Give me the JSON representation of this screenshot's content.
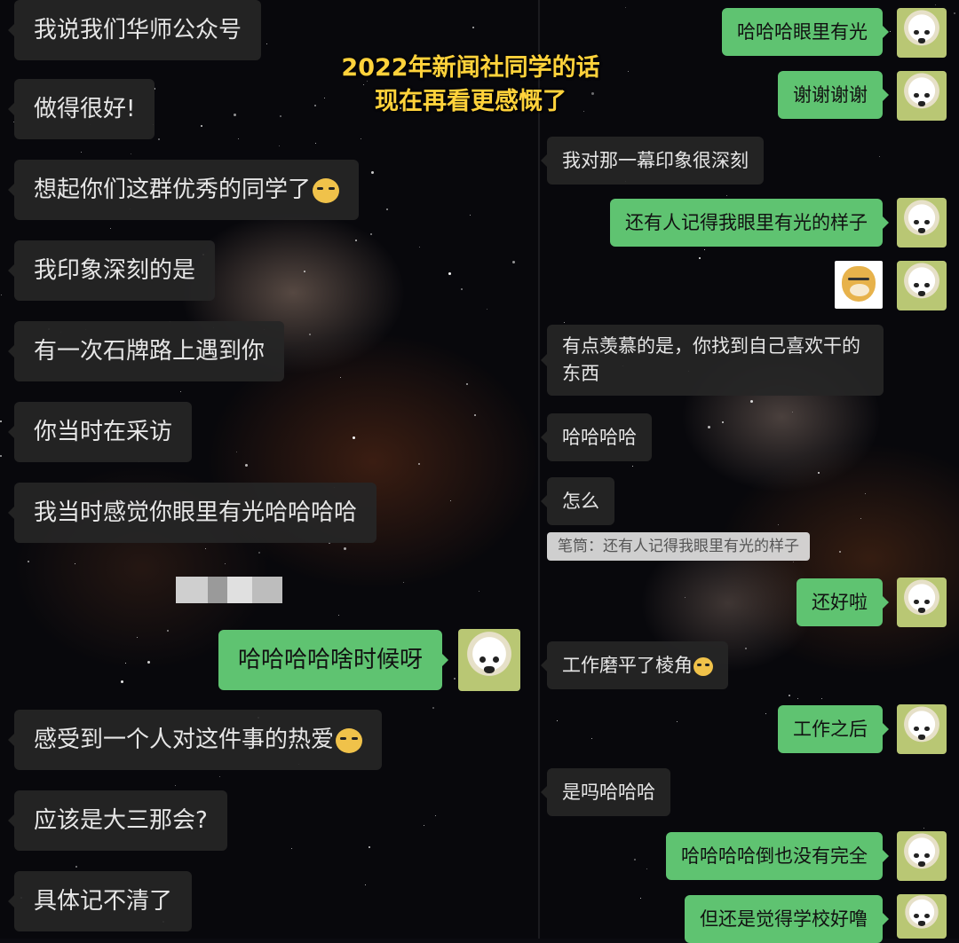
{
  "caption": {
    "line1": "2022年新闻社同学的话",
    "line2": "现在再看更感慨了"
  },
  "left_chat": {
    "messages": [
      {
        "text": "我说我们华师公众号"
      },
      {
        "text": "做得很好!"
      },
      {
        "text": "想起你们这群优秀的同学了",
        "emoji": "smirk-emoji"
      },
      {
        "text": "我印象深刻的是"
      },
      {
        "text": "有一次石牌路上遇到你"
      },
      {
        "text": "你当时在采访"
      },
      {
        "text": "我当时感觉你眼里有光哈哈哈哈"
      },
      {
        "text": "哈哈哈哈啥时候呀",
        "sender": "self"
      },
      {
        "text": "感受到一个人对这件事的热爱",
        "emoji": "smirk-emoji"
      },
      {
        "text": "应该是大三那会?"
      },
      {
        "text": "具体记不清了"
      }
    ],
    "redacted": "blurred-name"
  },
  "right_chat": {
    "messages": [
      {
        "text": "哈哈哈眼里有光",
        "sender": "self"
      },
      {
        "text": "谢谢谢谢",
        "sender": "self"
      },
      {
        "text": "我对那一幕印象很深刻"
      },
      {
        "text": "还有人记得我眼里有光的样子",
        "sender": "self"
      },
      {
        "sticker": "doge-sticker",
        "sender": "self"
      },
      {
        "text": "有点羡慕的是，你找到自己喜欢干的东西"
      },
      {
        "text": "哈哈哈哈"
      },
      {
        "text": "怎么"
      },
      {
        "text": "还好啦",
        "sender": "self"
      },
      {
        "text": "工作磨平了棱角",
        "emoji": "smirk-emoji"
      },
      {
        "text": "工作之后",
        "sender": "self"
      },
      {
        "text": "是吗哈哈哈"
      },
      {
        "text": "哈哈哈哈倒也没有完全",
        "sender": "self"
      },
      {
        "text": "但还是觉得学校好噜",
        "sender": "self"
      }
    ],
    "quote": {
      "text": "笔筒：还有人记得我眼里有光的样子"
    }
  },
  "colors": {
    "incoming_bubble": "#262626",
    "outgoing_bubble": "#5fc371",
    "caption": "#ffd23b",
    "background": "#08080c"
  }
}
